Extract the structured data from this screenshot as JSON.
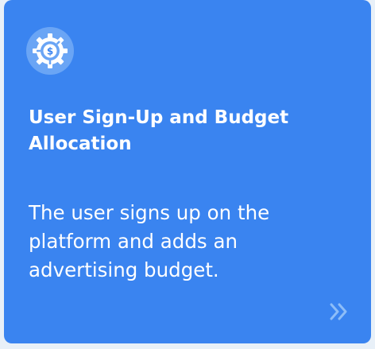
{
  "card": {
    "icon": "budget-gear-dollar-icon",
    "title": "User Sign-Up and Budget Allocation",
    "description": "The user signs up on the platform and adds an advertising budget.",
    "next_icon": "double-chevron-right-icon"
  },
  "colors": {
    "card_background": "#3a84f0",
    "icon_circle": "#6aa5f5",
    "text": "#ffffff",
    "next_arrow": "#8dbdf8"
  }
}
